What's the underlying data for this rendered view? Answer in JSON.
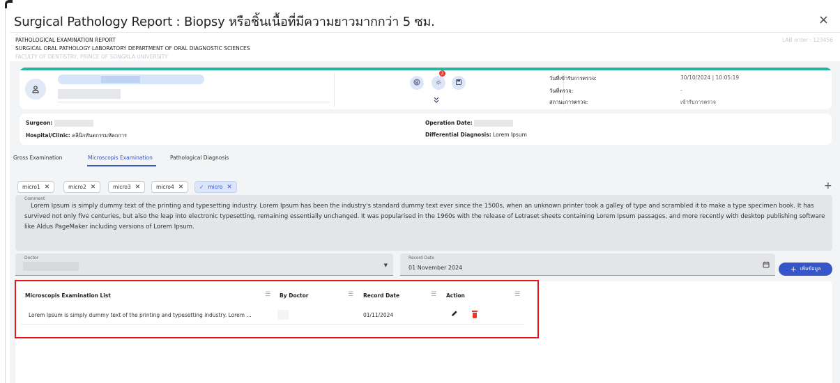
{
  "dialog": {
    "title": "Surgical Pathology Report : Biopsy หรือชิ้นเนื้อที่มีความยาวมากกว่า 5 ซม.",
    "close": "×"
  },
  "report_header": {
    "line1": "PATHOLOGICAL EXAMINATION REPORT",
    "line2": "SURGICAL ORAL PATHOLOGY LABORATORY DEPARTMENT OF ORAL DIAGNOSTIC SCIENCES",
    "line3": "FACULTY OF DENTISTRY, PRINCE OF SONGKLA UNIVERSITY",
    "lab_order": "LAB order : 123456"
  },
  "patient": {
    "avatar": "person-icon",
    "notification_count": "2",
    "expand_icon": "»",
    "info": [
      {
        "label": "วันที่เข้ารับการตรวจ:",
        "value": "30/10/2024 | 10:05:19"
      },
      {
        "label": "วันที่ตรวจ:",
        "value": "-"
      },
      {
        "label": "สถานะการตรวจ:",
        "value": "เข้ารับการตรวจ"
      }
    ]
  },
  "surgeon_info": {
    "surgeon_label": "Surgeon:",
    "hospital_label": "Hospital/Clinic:",
    "hospital_value": "คลินิกทันตกรรมหัตถการ",
    "operation_date_label": "Operation Date:",
    "diff_dx_label": "Differential Diagnosis:",
    "diff_dx_value": "Lorem Ipsum"
  },
  "tabs": [
    {
      "label": "Gross Examination",
      "active": false
    },
    {
      "label": "Microscopis Examination",
      "active": true
    },
    {
      "label": "Pathological Diagnosis",
      "active": false
    }
  ],
  "chips": [
    {
      "label": "micro1",
      "active": false
    },
    {
      "label": "micro2",
      "active": false
    },
    {
      "label": "micro3",
      "active": false
    },
    {
      "label": "micro4",
      "active": false
    },
    {
      "label": "micro",
      "active": true
    }
  ],
  "comment": {
    "label": "Comment",
    "text": "Lorem Ipsum is simply dummy text of the printing and typesetting industry. Lorem Ipsum has been the industry's standard dummy text ever since the 1500s, when an unknown printer took a galley of type and scrambled it to make a type specimen book. It has survived not only five centuries, but also the leap into electronic typesetting, remaining essentially unchanged. It was popularised in the 1960s with the release of Letraset sheets containing Lorem Ipsum passages, and more recently with desktop publishing software like Aldus PageMaker including versions of Lorem Ipsum."
  },
  "form": {
    "doctor_label": "Doctor",
    "record_date_label": "Record Date",
    "record_date_value": "01 November 2024",
    "add_button": "เพิ่มข้อมูล"
  },
  "list": {
    "columns": [
      "Microscopis Examination List",
      "By Doctor",
      "Record Date",
      "Action"
    ],
    "rows": [
      {
        "text": "Lorem Ipsum is simply dummy text of the printing and typesetting industry. Lorem ...",
        "doctor": "",
        "date": "01/11/2024"
      }
    ]
  },
  "colors": {
    "accent": "#3555c8",
    "teal_bar": "#2ab3a0",
    "delete": "#e53935",
    "highlight_frame": "#e01818"
  }
}
